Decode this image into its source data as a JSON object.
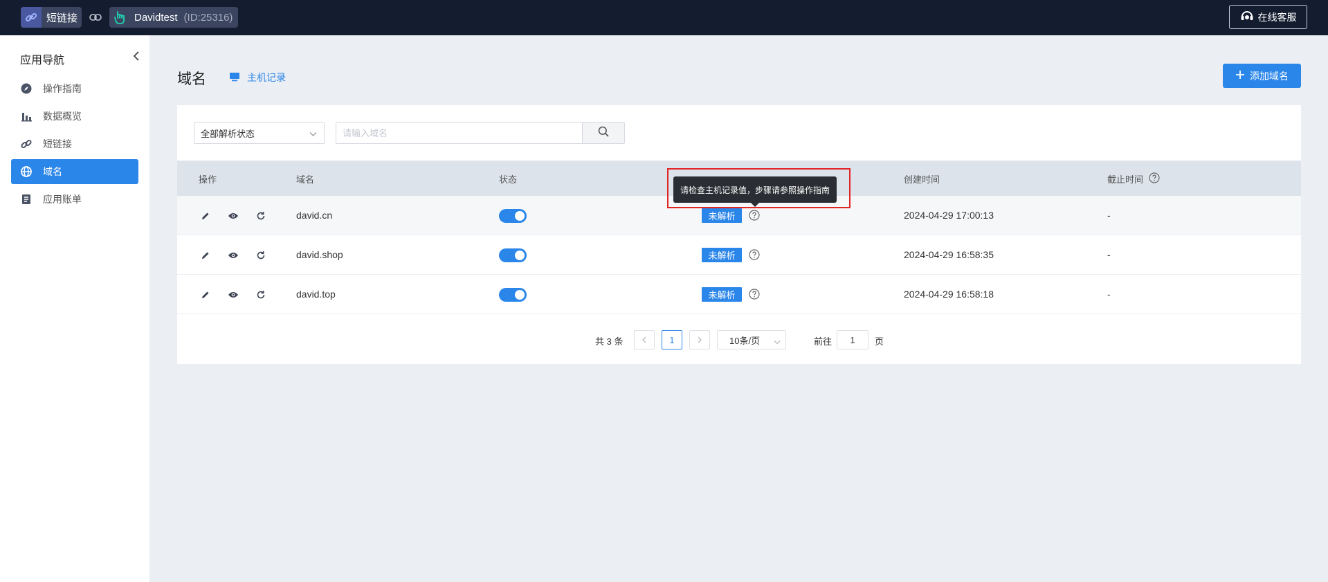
{
  "topbar": {
    "app_label": "短链接",
    "user_name": "Davidtest",
    "user_id": "(ID:25316)",
    "support_label": "在线客服"
  },
  "sidebar": {
    "title": "应用导航",
    "items": [
      {
        "label": "操作指南",
        "icon": "compass-icon"
      },
      {
        "label": "数据概览",
        "icon": "bar-chart-icon"
      },
      {
        "label": "短链接",
        "icon": "link-icon"
      },
      {
        "label": "域名",
        "icon": "globe-icon",
        "active": true
      },
      {
        "label": "应用账单",
        "icon": "document-icon"
      }
    ]
  },
  "header": {
    "title": "域名",
    "host_record_label": "主机记录",
    "add_button_label": "添加域名"
  },
  "filters": {
    "status_select": "全部解析状态",
    "search_placeholder": "请输入域名"
  },
  "table": {
    "columns": [
      "操作",
      "域名",
      "状态",
      "",
      "创建时间",
      "截止时间"
    ],
    "rows": [
      {
        "domain": "david.cn",
        "enabled": true,
        "resolve_status": "未解析",
        "created": "2024-04-29 17:00:13",
        "expires": "-"
      },
      {
        "domain": "david.shop",
        "enabled": true,
        "resolve_status": "未解析",
        "created": "2024-04-29 16:58:35",
        "expires": "-"
      },
      {
        "domain": "david.top",
        "enabled": true,
        "resolve_status": "未解析",
        "created": "2024-04-29 16:58:18",
        "expires": "-"
      }
    ]
  },
  "pagination": {
    "total": "共 3 条",
    "current_page": "1",
    "page_size": "10条/页",
    "goto_label": "前往",
    "goto_value": "1",
    "page_suffix": "页"
  },
  "tooltip": {
    "text": "请检查主机记录值，步骤请参照操作指南"
  },
  "colors": {
    "accent": "#2b86ea",
    "topbar": "#141c2f",
    "highlight": "#e12424"
  }
}
